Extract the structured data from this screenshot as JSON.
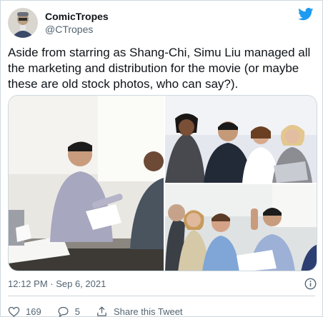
{
  "account": {
    "name": "ComicTropes",
    "handle": "@CTropes",
    "avatar_icon": "avatar-portrait",
    "platform_icon": "twitter-bird-icon",
    "platform_color": "#1d9bf0"
  },
  "tweet": {
    "text": "Aside from starring as Shang-Chi, Simu Liu managed all the marketing and distribution for the movie (or maybe these are old stock photos, who can say?).",
    "timestamp": "12:12 PM · Sep 6, 2021"
  },
  "media": {
    "photos": [
      {
        "subject": "man-presenting-at-meeting-table"
      },
      {
        "subject": "group-around-laptop"
      },
      {
        "subject": "team-laughing-at-table"
      }
    ]
  },
  "actions": {
    "likes": "169",
    "replies": "5",
    "share_label": "Share this Tweet",
    "like_icon": "heart-icon",
    "reply_icon": "reply-bubble-icon",
    "share_icon": "share-icon",
    "info_icon": "info-icon"
  },
  "colors": {
    "text": "#0f1419",
    "secondary": "#536471",
    "border": "#cfd9de",
    "brand": "#1d9bf0"
  }
}
